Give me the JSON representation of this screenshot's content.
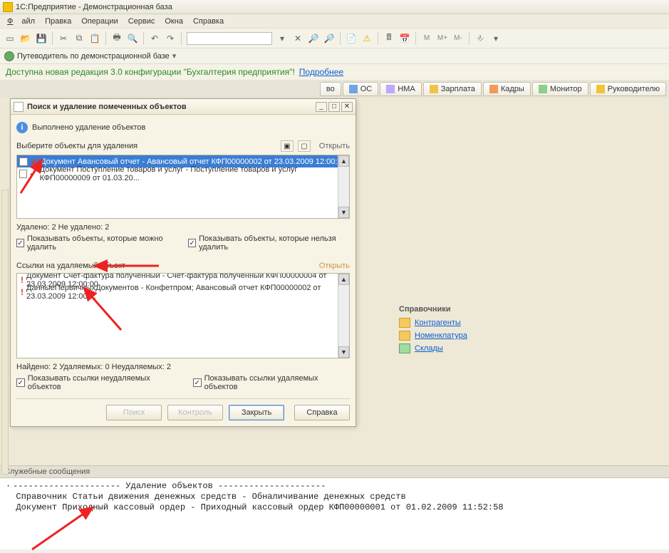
{
  "titlebar": {
    "text": "1С:Предприятие - Демонстрационная база"
  },
  "menu": {
    "file": "Файл",
    "edit": "Правка",
    "ops": "Операции",
    "service": "Сервис",
    "windows": "Окна",
    "help": "Справка"
  },
  "guidebar": {
    "text": "Путеводитель по демонстрационной базе",
    "chev": "▾"
  },
  "notice": {
    "text": "Доступна новая редакция 3.0 конфигурации \"Бухгалтерия предприятия\"!",
    "link": "Подробнее"
  },
  "tabs": {
    "t0": "во",
    "t1": "ОС",
    "t2": "НМА",
    "t3": "Зарплата",
    "t4": "Кадры",
    "t5": "Монитор",
    "t6": "Руководителю"
  },
  "side": {
    "header": "Справочники",
    "contr": "Контрагенты",
    "nomen": "Номенклатура",
    "skl": "Склады"
  },
  "dialog": {
    "title": "Поиск и удаление помеченных объектов",
    "info": "Выполнено удаление объектов",
    "choose": "Выберите объекты для удаления",
    "open": "Открыть",
    "row1": "Документ Авансовый отчет - Авансовый отчет КФП00000002 от 23.03.2009 12:00:01",
    "row2": "Документ Поступление товаров и услуг - Поступление товаров и услуг КФП00000009 от 01.03.20...",
    "stat1": "Удалено: 2  Не удалено: 2",
    "chk_removable": "Показывать объекты, которые можно удалить",
    "chk_nonremovable": "Показывать объекты, которые нельзя удалить",
    "refs_header": "Ссылки на удаляемый объект",
    "open2": "Открыть",
    "ref1": "Документ Счет-фактура полученный - Счет-фактура полученный КФП00000004 от 23.03.2009 12:00:00",
    "ref2": "ДанныеПервичныхДокументов  - Конфетпром; Авансовый отчет КФП00000002 от 23.03.2009 12:00:...",
    "stat2": "Найдено: 2  Удаляемых: 0  Неудаляемых: 2",
    "chk_refs_nonrem": "Показывать ссылки неудаляемых объектов",
    "chk_refs_rem": "Показывать ссылки удаляемых объектов",
    "btn_search": "Поиск",
    "btn_check": "Контроль",
    "btn_close": "Закрыть",
    "btn_help": "Справка"
  },
  "sm": {
    "header": "Служебные сообщения",
    "l1": "--------------------- Удаление объектов ---------------------",
    "l2": "Справочник Статьи движения денежных средств - Обналичивание денежных средств",
    "l3": "Документ Приходный кассовый ордер - Приходный кассовый ордер КФП00000001 от 01.02.2009 11:52:58"
  }
}
